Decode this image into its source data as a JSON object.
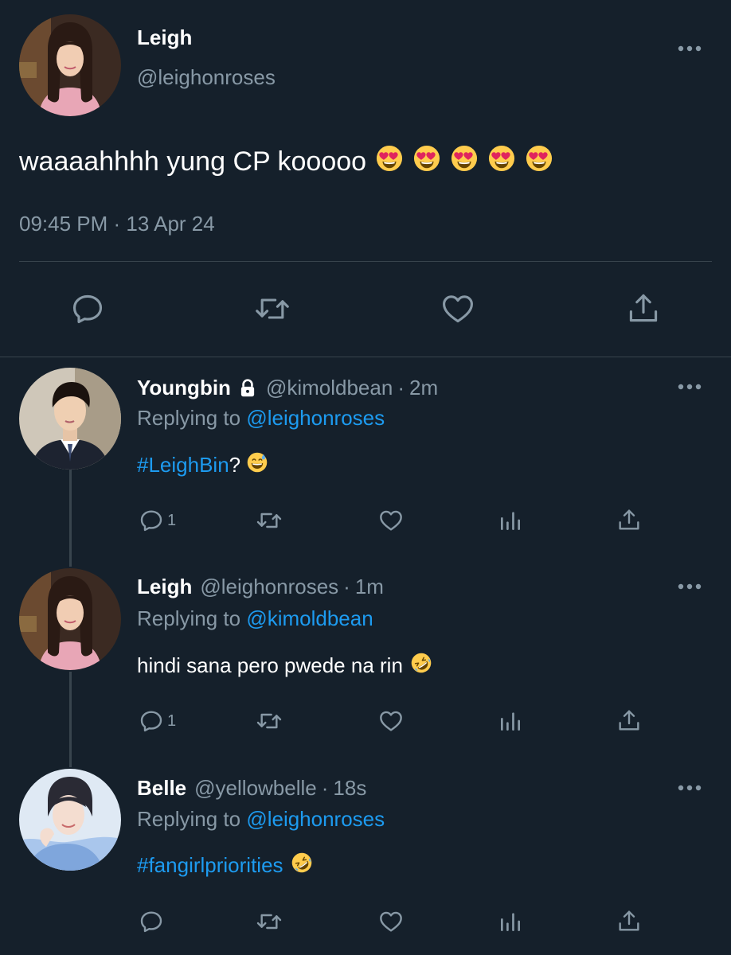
{
  "main_tweet": {
    "author_name": "Leigh",
    "author_handle": "@leighonroses",
    "text": "waaaahhhh yung CP kooooo",
    "emojis": [
      "heart-eyes-emoji",
      "heart-eyes-emoji",
      "heart-eyes-emoji",
      "heart-eyes-emoji",
      "heart-eyes-emoji"
    ],
    "timestamp": "09:45 PM · 13 Apr 24",
    "actions": [
      "reply-icon",
      "retweet-icon",
      "like-icon",
      "share-icon"
    ]
  },
  "replies": [
    {
      "author_name": "Youngbin",
      "locked": true,
      "handle": "@kimoldbean",
      "separator": "·",
      "time": "2m",
      "replying_prefix": "Replying to",
      "replying_to": "@leighonroses",
      "hashtag": "#LeighBin",
      "text_after": "?",
      "emoji": "sweat-smile-emoji",
      "reply_count": "1"
    },
    {
      "author_name": "Leigh",
      "locked": false,
      "handle": "@leighonroses",
      "separator": "·",
      "time": "1m",
      "replying_prefix": "Replying to",
      "replying_to": "@kimoldbean",
      "text": "hindi sana pero pwede na rin",
      "emoji": "rofl-emoji",
      "reply_count": "1"
    },
    {
      "author_name": "Belle",
      "locked": false,
      "handle": "@yellowbelle",
      "separator": "·",
      "time": "18s",
      "replying_prefix": "Replying to",
      "replying_to": "@leighonroses",
      "hashtag": "#fangirlpriorities",
      "emoji": "rofl-emoji",
      "reply_count": ""
    }
  ],
  "colors": {
    "background": "#15202b",
    "text_primary": "#ffffff",
    "text_secondary": "#8899a6",
    "accent": "#1d9bf0",
    "divider": "#38444d"
  }
}
